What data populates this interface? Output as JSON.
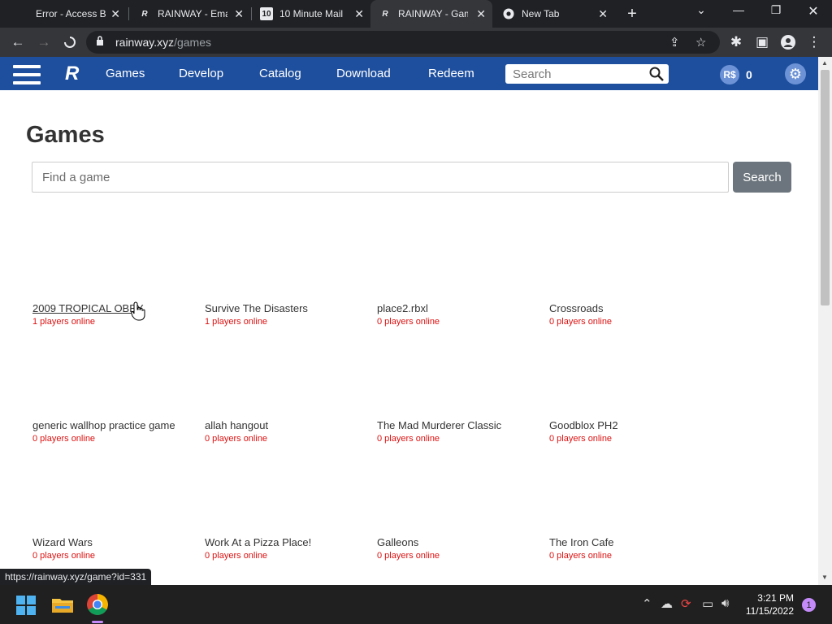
{
  "browser": {
    "tabs": [
      {
        "title": "Error - Access Bl",
        "favicon": "E"
      },
      {
        "title": "RAINWAY - Ema",
        "favicon": "R"
      },
      {
        "title": "10 Minute Mail",
        "favicon": "10"
      },
      {
        "title": "RAINWAY - Gam",
        "favicon": "R"
      },
      {
        "title": "New Tab",
        "favicon": "G"
      }
    ],
    "url_host": "rainway.xyz",
    "url_path": "/games",
    "status_url": "https://rainway.xyz/game?id=331"
  },
  "site": {
    "logo": "R",
    "nav": [
      "Games",
      "Develop",
      "Catalog",
      "Download",
      "Redeem"
    ],
    "search_placeholder": "Search",
    "currency_label": "R$",
    "currency_amount": "0"
  },
  "main": {
    "title": "Games",
    "search_placeholder": "Find a game",
    "search_button": "Search",
    "games": [
      {
        "name": "2009 TROPICAL OBBY",
        "online": "1 players online"
      },
      {
        "name": "Survive The Disasters",
        "online": "1 players online"
      },
      {
        "name": "place2.rbxl",
        "online": "0 players online"
      },
      {
        "name": "Crossroads",
        "online": "0 players online"
      },
      {
        "name": "generic wallhop practice game",
        "online": "0 players online"
      },
      {
        "name": "allah hangout",
        "online": "0 players online"
      },
      {
        "name": "The Mad Murderer Classic",
        "online": "0 players online"
      },
      {
        "name": "Goodblox PH2",
        "online": "0 players online"
      },
      {
        "name": "Wizard Wars",
        "online": "0 players online"
      },
      {
        "name": "Work At a Pizza Place!",
        "online": "0 players online"
      },
      {
        "name": "Galleons",
        "online": "0 players online"
      },
      {
        "name": "The Iron Cafe",
        "online": "0 players online"
      }
    ]
  },
  "taskbar": {
    "time": "3:21 PM",
    "date": "11/15/2022",
    "notifications": "1"
  },
  "colors": {
    "navbar": "#1e4f9e",
    "online_text": "#dd1111"
  }
}
